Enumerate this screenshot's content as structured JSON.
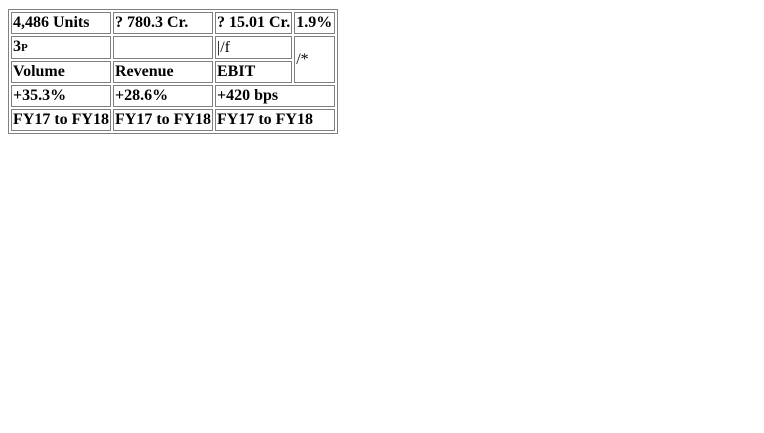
{
  "table": {
    "row1": {
      "units": "4,486 Units",
      "revenue_value": "? 780.3 Cr.",
      "ebit_value": "? 15.01 Cr.",
      "ebit_margin": "1.9%"
    },
    "row2": {
      "col1_main": "3",
      "col1_small": "P",
      "col2": "",
      "col3": "|/f",
      "col4": "/*"
    },
    "row3": {
      "volume_label": "Volume",
      "revenue_label": "Revenue",
      "ebit_label": "EBIT"
    },
    "row4": {
      "volume_growth": "+35.3%",
      "revenue_growth": "+28.6%",
      "ebit_change": "+420 bps"
    },
    "row5": {
      "period_1": "FY17 to FY18",
      "period_2": "FY17 to FY18",
      "period_3": "FY17 to FY18"
    }
  }
}
